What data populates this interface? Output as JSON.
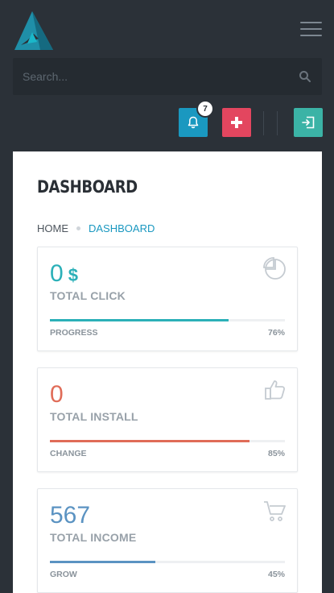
{
  "search": {
    "placeholder": "Search..."
  },
  "notifications": {
    "count": "7"
  },
  "page": {
    "title": "DASHBOARD",
    "breadcrumb": {
      "home": "HOME",
      "current": "DASHBOARD"
    }
  },
  "colors": {
    "background": "#2b3138",
    "bell_button": "#1a98c0",
    "plus_button": "#e3465f",
    "exit_button": "#3bb3a6",
    "teal": "#2bb0b8",
    "red": "#e06c58",
    "blue": "#5b93c2"
  },
  "cards": [
    {
      "value": "0",
      "unit": "$",
      "label": "TOTAL CLICK",
      "footer_left": "PROGRESS",
      "footer_right": "76%",
      "progress": 0.76,
      "icon": "pie-chart-icon",
      "color": "#2bb0b8"
    },
    {
      "value": "0",
      "unit": "",
      "label": "TOTAL INSTALL",
      "footer_left": "CHANGE",
      "footer_right": "85%",
      "progress": 0.85,
      "icon": "thumbs-up-icon",
      "color": "#e06c58"
    },
    {
      "value": "567",
      "unit": "",
      "label": "TOTAL INCOME",
      "footer_left": "GROW",
      "footer_right": "45%",
      "progress": 0.45,
      "icon": "cart-icon",
      "color": "#5b93c2"
    }
  ]
}
